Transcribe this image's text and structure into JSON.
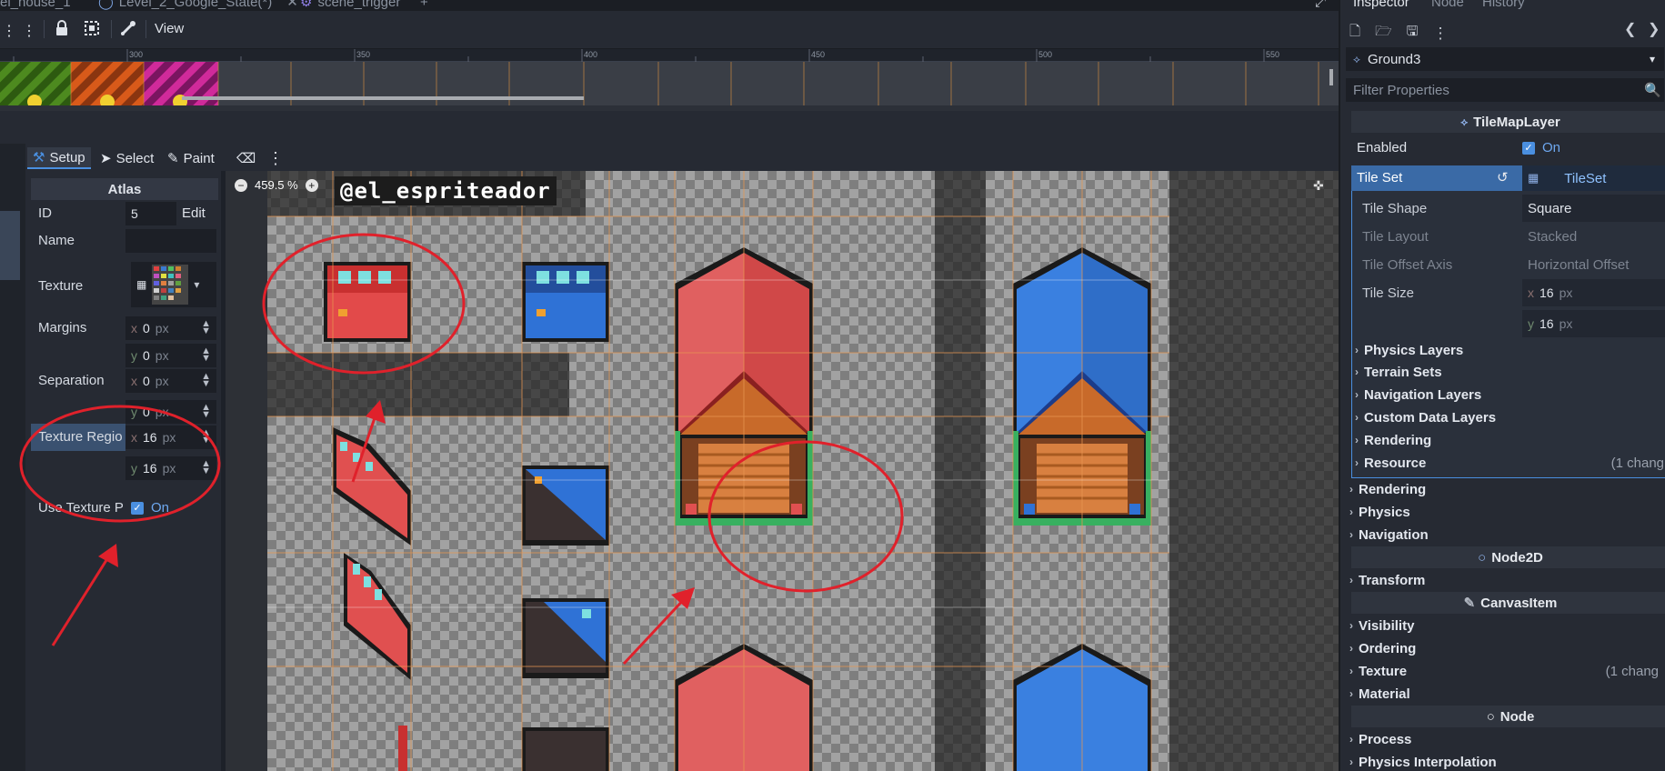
{
  "tabs": {
    "items": [
      {
        "label": "el_house_1"
      },
      {
        "label": "Level_2_Google_State(*)",
        "active": true
      },
      {
        "label": "scene_trigger"
      }
    ],
    "add": "+"
  },
  "toolbar": {
    "view": "View"
  },
  "ruler": {
    "ticks": [
      "300",
      "350",
      "400",
      "450",
      "500",
      "550"
    ]
  },
  "tileset_toolbar": {
    "setup": "Setup",
    "select": "Select",
    "paint": "Paint"
  },
  "atlas": {
    "title": "Atlas",
    "id_label": "ID",
    "id_value": "5",
    "edit": "Edit",
    "name_label": "Name",
    "name_value": "",
    "texture_label": "Texture",
    "margins_label": "Margins",
    "margins_x": "0",
    "margins_y": "0",
    "separation_label": "Separation",
    "separation_x": "0",
    "separation_y": "0",
    "region_label": "Texture Regio",
    "region_x": "16",
    "region_y": "16",
    "use_label": "Use Texture P",
    "use_value": "On",
    "unit": "px",
    "x": "x",
    "y": "y"
  },
  "canvas": {
    "zoom": "459.5 %",
    "watermark": "@el_espriteador"
  },
  "inspector": {
    "tabs": [
      "Inspector",
      "Node",
      "History"
    ],
    "node_name": "Ground3",
    "filter_placeholder": "Filter Properties",
    "section_title": "TileMapLayer",
    "enabled_label": "Enabled",
    "enabled_value": "On",
    "tileset_label": "Tile Set",
    "tileset_value": "TileSet",
    "tile_shape_label": "Tile Shape",
    "tile_shape_value": "Square",
    "tile_layout_label": "Tile Layout",
    "tile_layout_value": "Stacked",
    "tile_offset_label": "Tile Offset Axis",
    "tile_offset_value": "Horizontal Offset",
    "tile_size_label": "Tile Size",
    "tile_size_x": "16",
    "tile_size_y": "16",
    "unit": "px",
    "x": "x",
    "y": "y",
    "sub_groups": [
      "Physics Layers",
      "Terrain Sets",
      "Navigation Layers",
      "Custom Data Layers",
      "Rendering",
      "Resource"
    ],
    "resource_change": "(1 chang",
    "groups1": [
      "Rendering",
      "Physics",
      "Navigation"
    ],
    "node2d": "Node2D",
    "groups2": [
      "Transform"
    ],
    "canvasitem": "CanvasItem",
    "groups3": [
      "Visibility",
      "Ordering",
      "Texture",
      "Material"
    ],
    "texture_change": "(1 chang",
    "node": "Node",
    "groups4": [
      "Process",
      "Physics Interpolation"
    ]
  },
  "colors": {
    "accent": "#4a8fe0",
    "annotation": "#e0212b",
    "highlight": "#3a6aa6"
  }
}
